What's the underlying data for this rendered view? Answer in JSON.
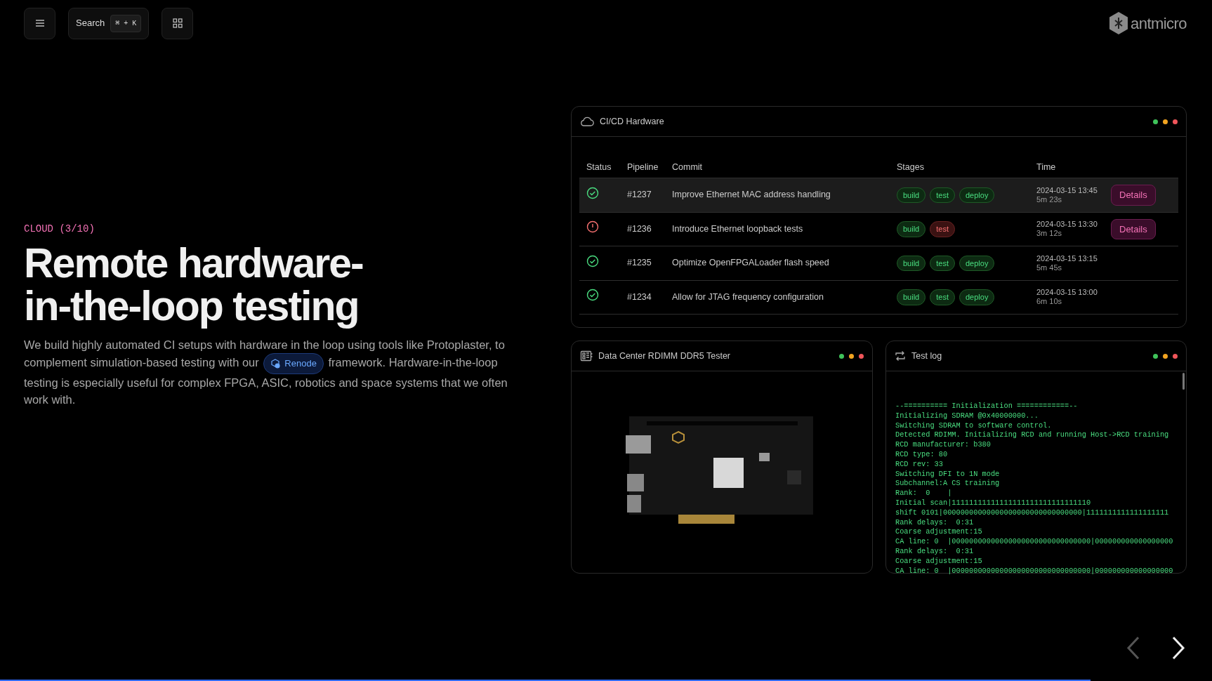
{
  "top_bar": {
    "search": {
      "label": "Search",
      "shortcut": "⌘ + K"
    },
    "logo": {
      "text": "antmicro"
    }
  },
  "hero": {
    "eyebrow": "CLOUD (3/10)",
    "heading_lines": [
      "Remote hardware-",
      "in-the-loop testing"
    ],
    "paragraph": {
      "before": "We build highly automated CI setups with hardware in the loop using tools like Protoplaster, to complement simulation-based testing with our",
      "link": "Renode",
      "after": "framework. Hardware-in-the-loop testing is especially useful for complex FPGA, ASIC, robotics and space systems that we often work with."
    }
  },
  "cicd_panel": {
    "title": "CI/CD Hardware",
    "columns": [
      "Status",
      "Pipeline",
      "Commit",
      "Stages",
      "Time"
    ],
    "rows": [
      {
        "kind": "success",
        "pipeline": "#1237",
        "commit": "Improve Ethernet MAC address handling",
        "stages": [
          {
            "label": "build",
            "kind": "pass"
          },
          {
            "label": "test",
            "kind": "pass"
          },
          {
            "label": "deploy",
            "kind": "pass"
          }
        ],
        "date": "2024-03-15 13:45",
        "duration": "5m 23s",
        "action": "Details",
        "selected": true
      },
      {
        "kind": "failure",
        "pipeline": "#1236",
        "commit": "Introduce Ethernet loopback tests",
        "stages": [
          {
            "label": "build",
            "kind": "pass"
          },
          {
            "label": "test",
            "kind": "fail"
          }
        ],
        "date": "2024-03-15 13:30",
        "duration": "3m 12s",
        "action": "Details",
        "selected": false
      },
      {
        "kind": "success",
        "pipeline": "#1235",
        "commit": "Optimize OpenFPGALoader flash speed",
        "stages": [
          {
            "label": "build",
            "kind": "pass"
          },
          {
            "label": "test",
            "kind": "pass"
          },
          {
            "label": "deploy",
            "kind": "pass"
          }
        ],
        "date": "2024-03-15 13:15",
        "duration": "5m 45s",
        "selected": false
      },
      {
        "kind": "success",
        "pipeline": "#1234",
        "commit": "Allow for JTAG frequency configuration",
        "stages": [
          {
            "label": "build",
            "kind": "pass"
          },
          {
            "label": "test",
            "kind": "pass"
          },
          {
            "label": "deploy",
            "kind": "pass"
          }
        ],
        "date": "2024-03-15 13:00",
        "duration": "6m 10s",
        "selected": false
      }
    ]
  },
  "tester_panel": {
    "title": "Data Center RDIMM DDR5 Tester"
  },
  "log_panel": {
    "title": "Test log",
    "lines": [
      "--========== Initialization ============--",
      "Initializing SDRAM @0x40000000...",
      "Switching SDRAM to software control.",
      "Detected RDIMM. Initializing RCD and running Host->RCD training",
      "RCD manufacturer: b380",
      "RCD type: 80",
      "RCD rev: 33",
      "Switching DFI to 1N mode",
      "Subchannel:A CS training",
      "Rank:  0    |",
      "Initial scan|11111111111111111111111111111110",
      "shift 0101|00000000000000000000000000000000|1111111111111111111",
      "Rank delays:  0:31",
      "Coarse adjustment:15",
      "CA line: 0  |00000000000000000000000000000000|000000000000000000",
      "Rank delays:  0:31",
      "Coarse adjustment:15",
      "CA line: 0  |00000000000000000000000000000000|000000000000000000"
    ]
  },
  "nav": {
    "previous": {
      "disabled": true
    },
    "next": {
      "disabled": false
    }
  },
  "progress": {
    "level": 0.9
  }
}
